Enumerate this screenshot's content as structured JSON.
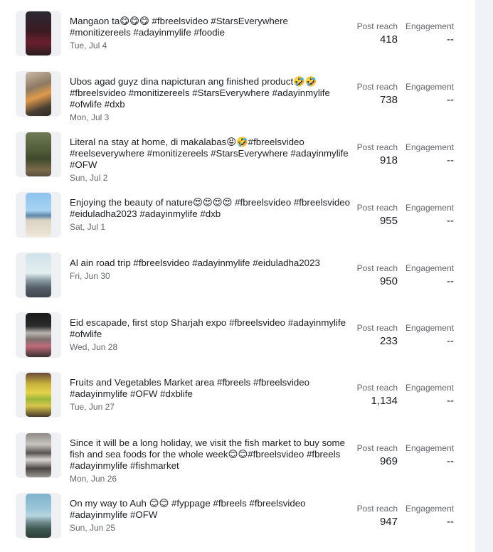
{
  "labels": {
    "reach": "Post reach",
    "engagement": "Engagement"
  },
  "posts": [
    {
      "caption": "Mangaon ta😋😋😋 #fbreelsvideo #StarsEverywhere #monitizereels #adayinmylife #foodie",
      "date": "Tue, Jul 4",
      "reach": "418",
      "engagement": "--"
    },
    {
      "caption": "Ubos agad guyz dina napicturan ang finished product🤣🤣 #fbreelsvideo #monitizereels #StarsEverywhere #adayinmylife #ofwlife #dxb",
      "date": "Mon, Jul 3",
      "reach": "738",
      "engagement": "--"
    },
    {
      "caption": "Literal na stay at home, di makalabas😝🤣#fbreelsvideo #reelseverywhere #monitizereels #StarsEverywhere #adayinmylife #OFW",
      "date": "Sun, Jul 2",
      "reach": "918",
      "engagement": "--"
    },
    {
      "caption": "Enjoying the beauty of nature😍😍😍😍 #fbreelsvideo #fbreelsvideo #eiduladha2023 #adayinmylife #dxb",
      "date": "Sat, Jul 1",
      "reach": "955",
      "engagement": "--"
    },
    {
      "caption": "Al ain road trip #fbreelsvideo #adayinmylife #eiduladha2023",
      "date": "Fri, Jun 30",
      "reach": "950",
      "engagement": "--"
    },
    {
      "caption": "Eid escapade, first stop Sharjah expo #fbreelsvideo #adayinmylife #ofwlife",
      "date": "Wed, Jun 28",
      "reach": "233",
      "engagement": "--"
    },
    {
      "caption": "Fruits and Vegetables Market area #fbreels #fbreelsvideo #adayinmylife #OFW #dxblife",
      "date": "Tue, Jun 27",
      "reach": "1,134",
      "engagement": "--"
    },
    {
      "caption": "Since it will be a long holiday, we visit the fish market to buy some fish and sea foods for the whole week😊😊#fbreelsvideo #fbreels #adayinmylife #fishmarket",
      "date": "Mon, Jun 26",
      "reach": "969",
      "engagement": "--"
    },
    {
      "caption": "On my way to Auh 😊😊 #fyppage #fbreels #fbreelsvideo #adayinmylife #OFW",
      "date": "Sun, Jun 25",
      "reach": "947",
      "engagement": "--"
    }
  ]
}
